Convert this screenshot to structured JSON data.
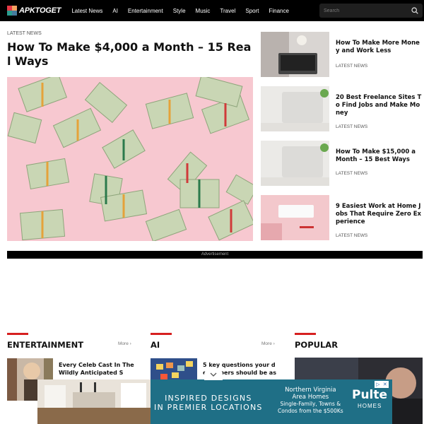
{
  "nav": {
    "logo": "APKTOGET",
    "items": [
      "Latest News",
      "AI",
      "Entertainment",
      "Style",
      "Music",
      "Travel",
      "Sport",
      "Finance"
    ],
    "search_placeholder": "Search"
  },
  "hero": {
    "kicker": "LATEST NEWS",
    "title": "How To Make $4,000 a Month – 15 Real Ways"
  },
  "side_articles": [
    {
      "title": "How To Make More Money and Work Less",
      "kicker": "LATEST NEWS"
    },
    {
      "title": "20 Best Freelance Sites To Find Jobs and Make Money",
      "kicker": "LATEST NEWS"
    },
    {
      "title": "How To Make $15,000 a Month – 15 Best Ways",
      "kicker": "LATEST NEWS"
    },
    {
      "title": "9 Easiest Work at Home Jobs That Require Zero Experience",
      "kicker": "LATEST NEWS"
    }
  ],
  "ad_label": "Advertisement",
  "sections": {
    "entertainment": {
      "title": "ENTERTAINMENT",
      "more": "More",
      "card_title": "Every Celeb Cast In The Wildly Anticipated S"
    },
    "ai": {
      "title": "AI",
      "more": "More",
      "card_title": "5 key questions your developers should be as"
    },
    "popular": {
      "title": "POPULAR"
    }
  },
  "ad_banner": {
    "line1": "INSPIRED DESIGNS",
    "line2": "IN PREMIER LOCATIONS",
    "mid_line1": "Northern Virginia",
    "mid_line2": "Area Homes",
    "mid_line3": "Single-Family, Towns &",
    "mid_line4": "Condos from the $500Ks",
    "brand": "Pulte",
    "brand_sub": "HOMES"
  },
  "colors": {
    "accent": "#d62020",
    "nav_bg": "#000000",
    "ad_bg": "#1f6f86"
  }
}
